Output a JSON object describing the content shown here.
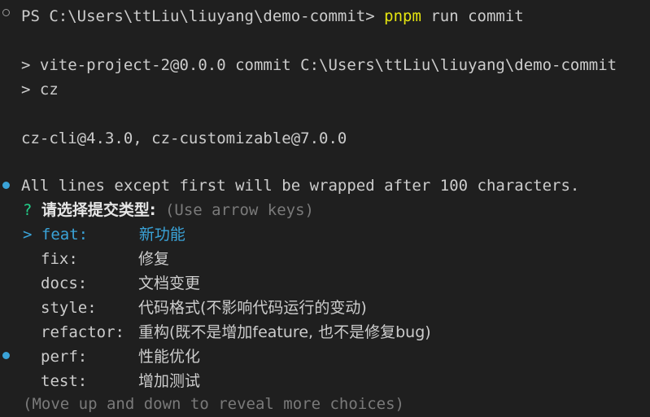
{
  "prompt": {
    "ps": "PS C:\\Users\\ttLiu\\liuyang\\demo-commit>",
    "command": "pnpm",
    "args": "run commit"
  },
  "script": {
    "line1": "> vite-project-2@0.0.0 commit C:\\Users\\ttLiu\\liuyang\\demo-commit",
    "line2": "> cz"
  },
  "versions": "cz-cli@4.3.0, cz-customizable@7.0.0",
  "notice": "All lines except first will be wrapped after 100 characters.",
  "question": {
    "mark": "?",
    "text": "请选择提交类型:",
    "hint": "(Use arrow keys)"
  },
  "choices": [
    {
      "key": "feat:",
      "desc": "新功能",
      "selected": true
    },
    {
      "key": "fix:",
      "desc": "修复",
      "selected": false
    },
    {
      "key": "docs:",
      "desc": "文档变更",
      "selected": false
    },
    {
      "key": "style:",
      "desc": "代码格式(不影响代码运行的变动)",
      "selected": false
    },
    {
      "key": "refactor:",
      "desc": "重构(既不是增加feature, 也不是修复bug)",
      "selected": false
    },
    {
      "key": "perf:",
      "desc": "性能优化",
      "selected": false
    },
    {
      "key": "test:",
      "desc": "增加测试",
      "selected": false
    }
  ],
  "pointer": ">",
  "footer": "(Move up and down to reveal more choices)",
  "colors": {
    "accent": "#3aa3d8",
    "command": "#e5e510",
    "background": "#1f1f1f"
  }
}
